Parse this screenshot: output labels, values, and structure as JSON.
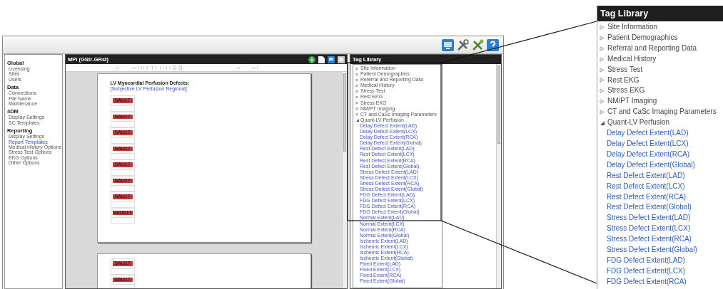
{
  "nav": {
    "sections": [
      {
        "title": "Global",
        "items": [
          {
            "label": "Licensing",
            "selected": false
          },
          {
            "label": "Sites",
            "selected": false
          },
          {
            "label": "Users",
            "selected": false
          }
        ]
      },
      {
        "title": "Data",
        "items": [
          {
            "label": "Connections",
            "selected": false
          },
          {
            "label": "File Name",
            "selected": false
          },
          {
            "label": "Maintenance",
            "selected": false
          }
        ]
      },
      {
        "title": "4DM",
        "items": [
          {
            "label": "Display Settings",
            "selected": false
          },
          {
            "label": "SC Templates",
            "selected": false
          }
        ]
      },
      {
        "title": "Reporting",
        "items": [
          {
            "label": "Display Settings",
            "selected": false
          },
          {
            "label": "Report Templates",
            "selected": true
          },
          {
            "label": "Medical History Options",
            "selected": false
          },
          {
            "label": "Stress Test Options",
            "selected": false
          },
          {
            "label": "EKG Options",
            "selected": false
          },
          {
            "label": "Other Options",
            "selected": false
          }
        ]
      }
    ]
  },
  "editor": {
    "title": "MPI (GStr-GRst)",
    "pages": [
      {
        "heading": "LV Myocardial Perfusion Defects:",
        "link": "[Subjective LV Perfusion Regional]",
        "tags": [
          "SAU17",
          "SAU17",
          "SAU17",
          "SAU17",
          "SAU17",
          "SAU17",
          "SAU17",
          "SAU017"
        ]
      },
      {
        "tags": [
          "SAU17",
          "SAU17"
        ]
      }
    ]
  },
  "tag_library": {
    "title": "Tag Library",
    "items": [
      {
        "label": "Site Information",
        "expanded": false
      },
      {
        "label": "Patient Demographics",
        "expanded": false
      },
      {
        "label": "Referral and Reporting Data",
        "expanded": false
      },
      {
        "label": "Medical History",
        "expanded": false
      },
      {
        "label": "Stress Test",
        "expanded": false
      },
      {
        "label": "Rest EKG",
        "expanded": false
      },
      {
        "label": "Stress EKG",
        "expanded": false
      },
      {
        "label": "NM/PT Imaging",
        "expanded": false
      },
      {
        "label": "CT and CaSc Imaging Parameters",
        "expanded": false
      },
      {
        "label": "Quant-LV Perfusion",
        "expanded": true,
        "children": [
          {
            "label": "Delay Defect Extent(LAD)"
          },
          {
            "label": "Delay Defect Extent(LCX)"
          },
          {
            "label": "Delay Defect Extent(RCA)"
          },
          {
            "label": "Delay Defect Extent(Global)"
          },
          {
            "label": "Rest Defect Extent(LAD)"
          },
          {
            "label": "Rest Defect Extent(LCX)"
          },
          {
            "label": "Rest Defect Extent(RCA)"
          },
          {
            "label": "Rest Defect Extent(Global)"
          },
          {
            "label": "Stress Defect Extent(LAD)"
          },
          {
            "label": "Stress Defect Extent(LCX)"
          },
          {
            "label": "Stress Defect Extent(RCA)"
          },
          {
            "label": "Stress Defect Extent(Global)"
          },
          {
            "label": "FDG Defect Extent(LAD)"
          },
          {
            "label": "FDG Defect Extent(LCX)"
          },
          {
            "label": "FDG Defect Extent(RCA)"
          },
          {
            "label": "FDG Defect Extent(Global)"
          },
          {
            "label": "Normal Extent(LAD)"
          },
          {
            "label": "Normal Extent(LCX)"
          },
          {
            "label": "Normal Extent(RCA)"
          },
          {
            "label": "Normal Extent(Global)"
          },
          {
            "label": "Ischemic Extent(LAD)"
          },
          {
            "label": "Ischemic Extent(LCX)"
          },
          {
            "label": "Ischemic Extent(RCA)"
          },
          {
            "label": "Ischemic Extent(Global)"
          },
          {
            "label": "Fixed Extent(LAD)"
          },
          {
            "label": "Fixed Extent(LCX)"
          },
          {
            "label": "Fixed Extent(RCA)"
          },
          {
            "label": "Fixed Extent(Global)"
          }
        ]
      }
    ]
  },
  "zoom_callout": {
    "title": "Tag Library",
    "items": [
      {
        "label": "Site Information",
        "expanded": false
      },
      {
        "label": "Patient Demographics",
        "expanded": false
      },
      {
        "label": "Referral and Reporting Data",
        "expanded": false
      },
      {
        "label": "Medical History",
        "expanded": false
      },
      {
        "label": "Stress Test",
        "expanded": false
      },
      {
        "label": "Rest EKG",
        "expanded": false
      },
      {
        "label": "Stress EKG",
        "expanded": false
      },
      {
        "label": "NM/PT Imaging",
        "expanded": false
      },
      {
        "label": "CT and CaSc Imaging Parameters",
        "expanded": false
      },
      {
        "label": "Quant-LV Perfusion",
        "expanded": true,
        "children": [
          {
            "label": "Delay Defect Extent(LAD)"
          },
          {
            "label": "Delay Defect Extent(LCX)"
          },
          {
            "label": "Delay Defect Extent(RCA)"
          },
          {
            "label": "Delay Defect Extent(Global)"
          },
          {
            "label": "Rest Defect Extent(LAD)"
          },
          {
            "label": "Rest Defect Extent(LCX)"
          },
          {
            "label": "Rest Defect Extent(RCA)"
          },
          {
            "label": "Rest Defect Extent(Global)"
          },
          {
            "label": "Stress Defect Extent(LAD)"
          },
          {
            "label": "Stress Defect Extent(LCX)"
          },
          {
            "label": "Stress Defect Extent(RCA)"
          },
          {
            "label": "Stress Defect Extent(Global)"
          },
          {
            "label": "FDG Defect Extent(LAD)"
          },
          {
            "label": "FDG Defect Extent(LCX)"
          },
          {
            "label": "FDG Defect Extent(RCA)"
          }
        ]
      }
    ]
  }
}
